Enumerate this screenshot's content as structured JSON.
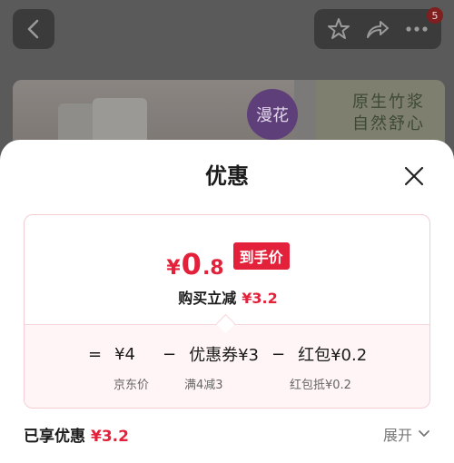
{
  "background": {
    "brand_logo": "漫花",
    "banner_line1": "原生竹浆",
    "banner_line2": "自然舒心",
    "notification_count": "5"
  },
  "sheet": {
    "title": "优惠"
  },
  "price": {
    "currency": "¥",
    "integer": "0",
    "decimal": ".8",
    "tag": "到手价",
    "instant_label": "购买立减",
    "instant_amount": "¥3.2"
  },
  "calc": {
    "equals": "=",
    "base_value": "¥4",
    "base_label": "京东价",
    "minus1": "−",
    "coupon_value": "优惠券¥3",
    "coupon_label": "满4减3",
    "minus2": "−",
    "redpack_value": "红包¥0.2",
    "redpack_label": "红包抵¥0.2"
  },
  "footer": {
    "enjoyed_label": "已享优惠",
    "enjoyed_value": "¥3.2",
    "expand_label": "展开"
  },
  "colors": {
    "accent": "#e4213a",
    "card_border": "#f3cdd2"
  }
}
